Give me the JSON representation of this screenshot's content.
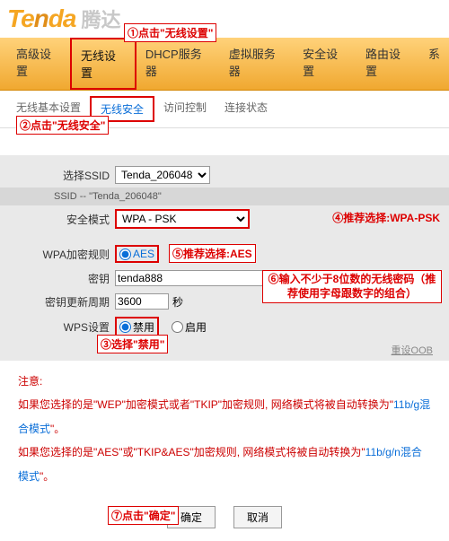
{
  "logo": {
    "text": "Tenda",
    "cn": "腾达"
  },
  "annotations": {
    "a1": "①点击\"无线设置\"",
    "a2": "②点击\"无线安全\"",
    "a3": "③选择\"禁用\"",
    "a4": "④推荐选择:WPA-PSK",
    "a5": "⑤推荐选择:AES",
    "a6": "⑥输入不少于8位数的无线密码（推荐使用字母跟数字的组合）",
    "a7": "⑦点击\"确定\""
  },
  "nav": {
    "items": [
      "高级设置",
      "无线设置",
      "DHCP服务器",
      "虚拟服务器",
      "安全设置",
      "路由设置",
      "系"
    ],
    "activeIndex": 1
  },
  "subnav": {
    "items": [
      "无线基本设置",
      "无线安全",
      "访问控制",
      "连接状态"
    ],
    "activeIndex": 1
  },
  "form": {
    "ssid_label": "选择SSID",
    "ssid_value": "Tenda_206048",
    "ssid_note_prefix": "SSID -- ",
    "ssid_note_value": "\"Tenda_206048\"",
    "sec_label": "安全模式",
    "sec_value": "WPA - PSK",
    "enc_label": "WPA加密规则",
    "enc_value": "AES",
    "key_label": "密钥",
    "key_value": "tenda888",
    "rekey_label": "密钥更新周期",
    "rekey_value": "3600",
    "rekey_unit": "秒",
    "wps_label": "WPS设置",
    "wps_disable": "禁用",
    "wps_enable": "启用",
    "reset_label": "重设OOB"
  },
  "notes": {
    "title": "注意:",
    "line1a": "如果您选择的是\"WEP\"加密模式或者\"TKIP\"加密规则, 网络模式将被自动转换为\"",
    "line1b": "11b/g混合模式",
    "line1c": "\"。",
    "line2a": "如果您选择的是\"AES\"或\"TKIP&AES\"加密规则, 网络模式将被自动转换为\"",
    "line2b": "11b/g/n混合模式",
    "line2c": "\"。"
  },
  "buttons": {
    "ok": "确定",
    "cancel": "取消"
  }
}
